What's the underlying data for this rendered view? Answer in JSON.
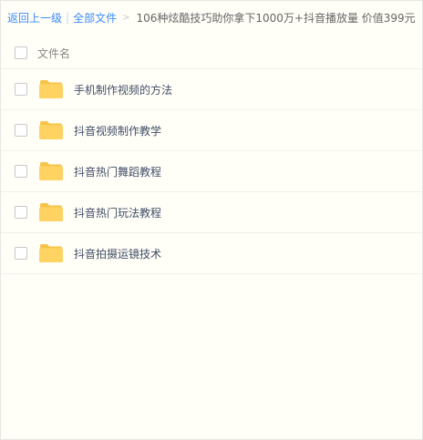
{
  "breadcrumb": {
    "back_label": "返回上一级",
    "separator": "|",
    "all_files_label": "全部文件",
    "arrow": ">",
    "current_folder": "106种炫酷技巧助你拿下1000万+抖音播放量 价值399元"
  },
  "table": {
    "column_header": "文件名",
    "rows": [
      {
        "name": "手机制作视频的方法",
        "type_icon": "folder-icon"
      },
      {
        "name": "抖音视频制作教学",
        "type_icon": "folder-icon"
      },
      {
        "name": "抖音热门舞蹈教程",
        "type_icon": "folder-icon"
      },
      {
        "name": "抖音热门玩法教程",
        "type_icon": "folder-icon"
      },
      {
        "name": "抖音拍摄运镜技术",
        "type_icon": "folder-icon"
      }
    ]
  },
  "colors": {
    "link": "#3b8cff",
    "folder": "#ffd362",
    "folder_tab": "#f7c44a",
    "background": "#fffef7"
  }
}
